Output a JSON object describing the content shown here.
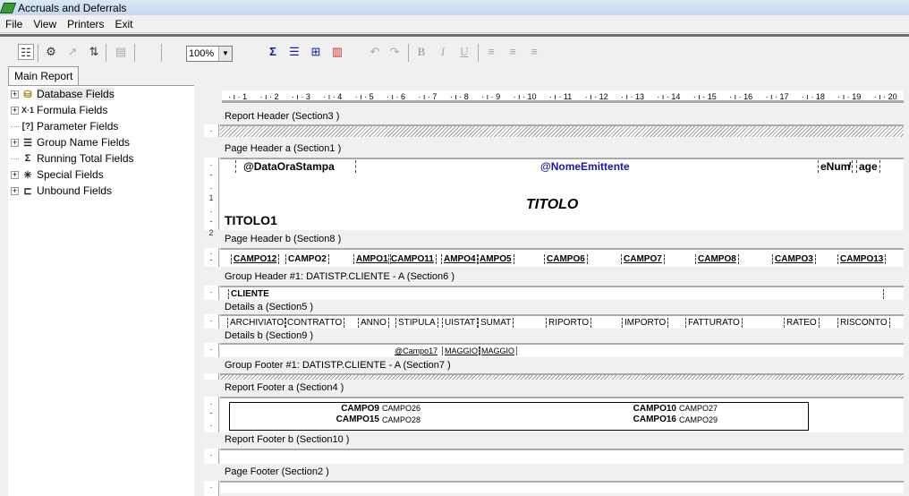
{
  "window": {
    "title": "Accruals and Deferrals"
  },
  "menu": [
    "File",
    "View",
    "Printers",
    "Exit"
  ],
  "toolbar": {
    "zoom": "100%",
    "bold": "B",
    "italic": "I",
    "underline": "U"
  },
  "tabs": [
    "Main Report"
  ],
  "tree": [
    {
      "label": "Database Fields",
      "icon": "database-icon",
      "icon_glyph": "⛁"
    },
    {
      "label": "Formula Fields",
      "icon": "formula-icon",
      "icon_glyph": "X·1"
    },
    {
      "label": "Parameter Fields",
      "icon": "parameter-icon",
      "icon_glyph": "[?]"
    },
    {
      "label": "Group Name Fields",
      "icon": "group-name-icon",
      "icon_glyph": "☰"
    },
    {
      "label": "Running Total Fields",
      "icon": "sigma-icon",
      "icon_glyph": "Σ"
    },
    {
      "label": "Special Fields",
      "icon": "special-icon",
      "icon_glyph": "✳"
    },
    {
      "label": "Unbound Fields",
      "icon": "unbound-icon",
      "icon_glyph": "⊏"
    }
  ],
  "ruler": [
    "1",
    "2",
    "3",
    "4",
    "5",
    "6",
    "7",
    "8",
    "9",
    "10",
    "11",
    "12",
    "13",
    "14",
    "15",
    "16",
    "17",
    "18",
    "19",
    "20"
  ],
  "sections": [
    "Report Header  (Section3 )",
    "Page Header a (Section1 )",
    "Page Header b (Section8 )",
    "Group Header #1: DATISTP.CLIENTE - A (Section6 )",
    "Details a (Section5 )",
    "Details b (Section9 )",
    "Group Footer #1: DATISTP.CLIENTE - A (Section7 )",
    "Report Footer a (Section4 )",
    "Report Footer b (Section10 )",
    "Page Footer  (Section2 )"
  ],
  "page_header_a": {
    "date": "@DataOraStampa",
    "issuer": "@NomeEmittente",
    "pagenum": "eNum",
    "slash": "/",
    "page": "age",
    "title": "TITOLO",
    "title1": "TITOLO1"
  },
  "page_header_b": [
    "CAMPO12",
    "CAMPO2",
    "AMPO1",
    "CAMPO11",
    "AMPO4",
    "AMPO5",
    "CAMPO6",
    "CAMPO7",
    "CAMPO8",
    "CAMPO3",
    "CAMPO13"
  ],
  "group_header": {
    "cliente": "CLIENTE"
  },
  "details_a": [
    "ARCHIVIATO",
    "CONTRATTO",
    "ANNO",
    "STIPULA",
    "UISTAT",
    "SUMAT",
    "RIPORTO",
    "IMPORTO",
    "FATTURATO",
    "RATEO",
    "RISCONTO"
  ],
  "details_b": [
    "@Campo17",
    "MAGGIO",
    "MAGGIO"
  ],
  "report_footer_a": {
    "c9": "CAMPO9",
    "c26": "CAMPO26",
    "c15": "CAMPO15",
    "c28": "CAMPO28",
    "c10": "CAMPO10",
    "c27": "CAMPO27",
    "c16": "CAMPO16",
    "c29": "CAMPO29"
  },
  "colors": {
    "issuer": "#1a1aa0",
    "title_bar": "#c4d7ec"
  }
}
